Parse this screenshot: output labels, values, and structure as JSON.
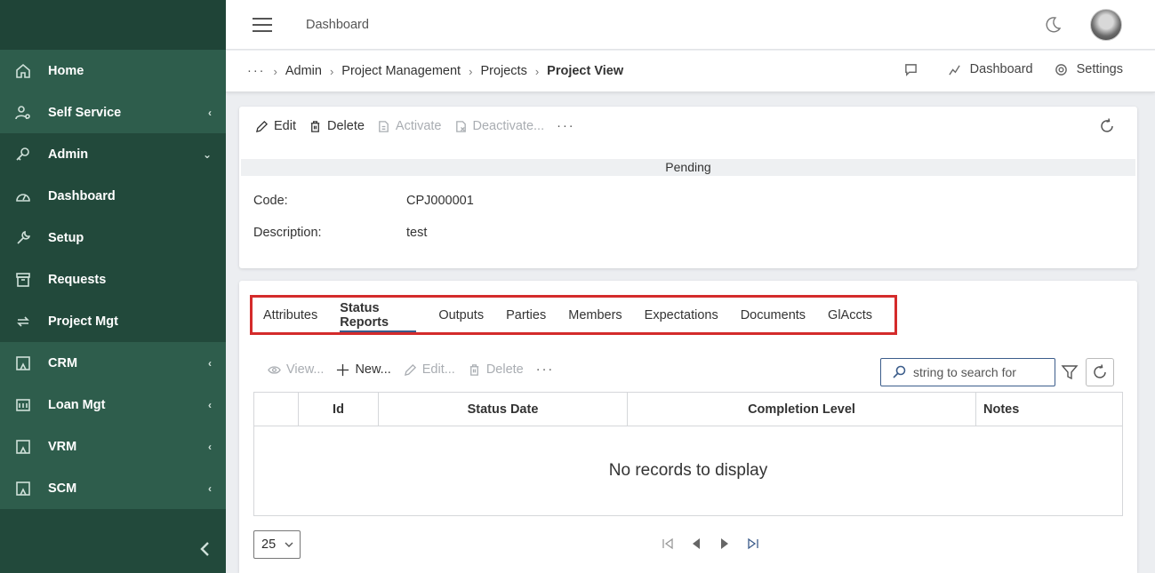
{
  "sidebar": {
    "items": [
      {
        "label": "Home",
        "icon": "home-icon",
        "chevron": ""
      },
      {
        "label": "Self Service",
        "icon": "user-gear-icon",
        "chevron": "‹"
      },
      {
        "label": "Admin",
        "icon": "key-icon",
        "chevron": "⌄"
      },
      {
        "label": "Dashboard",
        "icon": "gauge-icon",
        "chevron": ""
      },
      {
        "label": "Setup",
        "icon": "wrench-icon",
        "chevron": ""
      },
      {
        "label": "Requests",
        "icon": "archive-icon",
        "chevron": ""
      },
      {
        "label": "Project Mgt",
        "icon": "arrows-icon",
        "chevron": ""
      },
      {
        "label": "CRM",
        "icon": "frame-icon",
        "chevron": "‹"
      },
      {
        "label": "Loan Mgt",
        "icon": "bank-icon",
        "chevron": "‹"
      },
      {
        "label": "VRM",
        "icon": "frame-icon",
        "chevron": "‹"
      },
      {
        "label": "SCM",
        "icon": "frame-icon",
        "chevron": "‹"
      }
    ]
  },
  "topbar": {
    "title": "Dashboard"
  },
  "breadcrumb": {
    "more": "···",
    "items": [
      "Admin",
      "Project Management",
      "Projects"
    ],
    "current": "Project View",
    "actions": {
      "dashboard": "Dashboard",
      "settings": "Settings"
    }
  },
  "record_toolbar": {
    "edit": "Edit",
    "delete": "Delete",
    "activate": "Activate",
    "deactivate": "Deactivate...",
    "more": "···"
  },
  "record": {
    "status": "Pending",
    "code_label": "Code:",
    "code_value": "CPJ000001",
    "description_label": "Description:",
    "description_value": "test"
  },
  "tabs": [
    {
      "label": "Attributes",
      "active": false
    },
    {
      "label": "Status Reports",
      "active": true
    },
    {
      "label": "Outputs",
      "active": false
    },
    {
      "label": "Parties",
      "active": false
    },
    {
      "label": "Members",
      "active": false
    },
    {
      "label": "Expectations",
      "active": false
    },
    {
      "label": "Documents",
      "active": false
    },
    {
      "label": "GlAccts",
      "active": false
    }
  ],
  "grid_toolbar": {
    "view": "View...",
    "new": "New...",
    "edit": "Edit...",
    "delete": "Delete",
    "more": "···",
    "search_placeholder": "string to search for"
  },
  "grid": {
    "columns": [
      "",
      "Id",
      "Status Date",
      "Completion Level",
      "Notes"
    ],
    "empty_message": "No records to display"
  },
  "pager": {
    "page_size": "25"
  },
  "colors": {
    "sidebar": "#22493b",
    "sidebar_light": "#2e5d4c",
    "highlight": "#d42b2b",
    "accent": "#3b5b8a"
  }
}
